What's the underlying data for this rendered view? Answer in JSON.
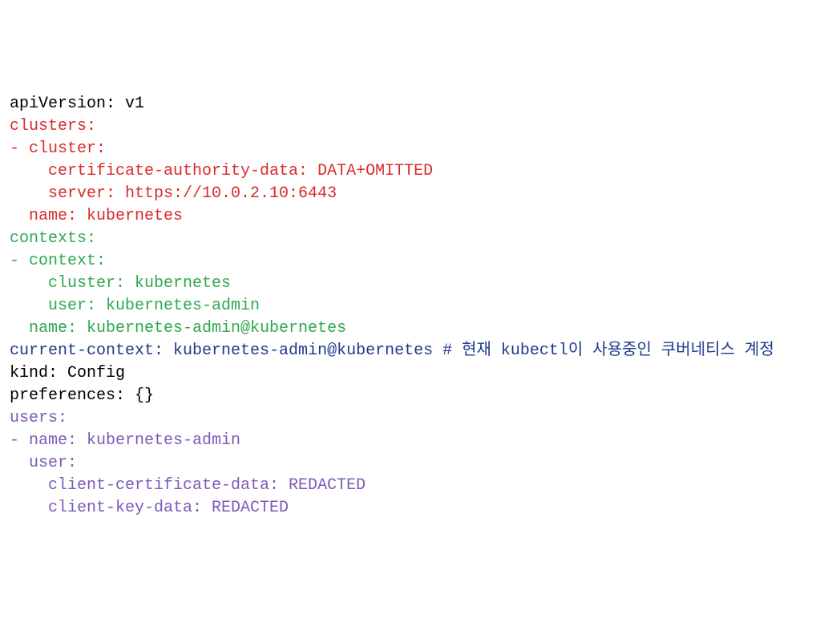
{
  "lines": {
    "l1": {
      "t1": "apiVersion: v1"
    },
    "l2": {
      "t1": "clusters:"
    },
    "l3": {
      "t1": "- cluster:"
    },
    "l4": {
      "t1": "    certificate-authority-data: DATA+OMITTED"
    },
    "l5": {
      "t1": "    server: https://10.0.2.10:6443"
    },
    "l6": {
      "t1": "  name: kubernetes"
    },
    "l7": {
      "t1": "contexts:"
    },
    "l8": {
      "t1": "- context:"
    },
    "l9": {
      "t1": "    cluster: kubernetes"
    },
    "l10": {
      "t1": "    user: kubernetes-admin"
    },
    "l11": {
      "t1": "  name: kubernetes-admin@kubernetes"
    },
    "l12": {
      "t1": "current-context: kubernetes-admin@kubernetes # 현재 kubectl이 사용중인 쿠버네티스 계정"
    },
    "l13": {
      "t1": "kind: Config"
    },
    "l14": {
      "t1": "preferences: {}"
    },
    "l15": {
      "t1": "users:"
    },
    "l16": {
      "t1": "- name: kubernetes-admin"
    },
    "l17": {
      "t1": "  user:"
    },
    "l18": {
      "t1": "    client-certificate-data: REDACTED"
    },
    "l19": {
      "t1": "    client-key-data: REDACTED"
    }
  }
}
